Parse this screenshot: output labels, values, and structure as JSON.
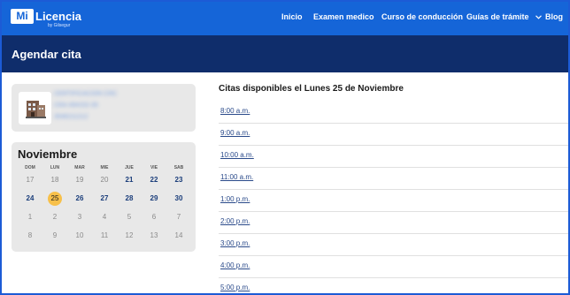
{
  "brand": {
    "mi": "Mi",
    "licencia": "Licencia",
    "by": "by Gilsegur"
  },
  "nav": [
    {
      "label": "Inicio"
    },
    {
      "label": "Examen medico"
    },
    {
      "label": "Curso de conducción"
    },
    {
      "label": "Guías de trámite"
    },
    {
      "label": "Blog"
    }
  ],
  "page_title": "Agendar cita",
  "location": {
    "name": "CERTIFICACION CRC",
    "address": "CRA 45#152-35",
    "phone": "3546211212"
  },
  "calendar": {
    "month": "Noviembre",
    "weekdays": [
      "DOM",
      "LUN",
      "MAR",
      "MIE",
      "JUE",
      "VIE",
      "SAB"
    ],
    "weeks": [
      [
        "17",
        "18",
        "19",
        "20",
        "21",
        "22",
        "23"
      ],
      [
        "24",
        "25",
        "26",
        "27",
        "28",
        "29",
        "30"
      ],
      [
        "1",
        "2",
        "3",
        "4",
        "5",
        "6",
        "7"
      ],
      [
        "8",
        "9",
        "10",
        "11",
        "12",
        "13",
        "14"
      ]
    ],
    "selected_day": "25"
  },
  "slots_title": "Citas disponibles el Lunes 25 de Noviembre",
  "slots": [
    "8:00 a.m.",
    "9:00 a.m.",
    "10:00 a.m.",
    "11:00 a.m.",
    "1:00 p.m.",
    "2:00 p.m.",
    "3:00 p.m.",
    "4:00 p.m.",
    "5:00 p.m."
  ],
  "colors": {
    "nav_bg": "#1565d8",
    "title_bg": "#0f2d6b",
    "selected_day": "#f7c04a",
    "link": "#2a4a8a"
  },
  "icons": [
    "building-icon",
    "chevron-down-icon"
  ]
}
